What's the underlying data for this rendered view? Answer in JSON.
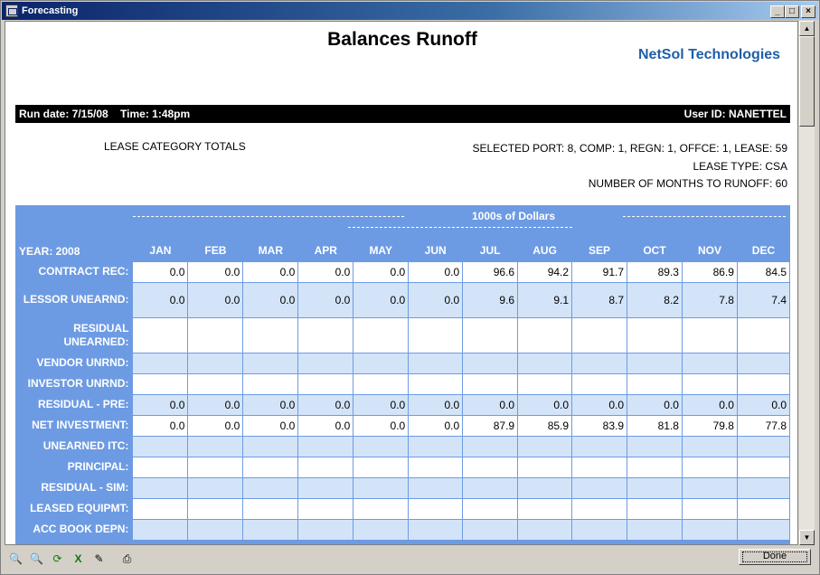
{
  "window": {
    "title": "Forecasting",
    "controls": [
      "_",
      "□",
      "×"
    ]
  },
  "report": {
    "title": "Balances Runoff",
    "brand": "NetSol Technologies",
    "run_info": "Run date: 7/15/08    Time: 1:48pm",
    "user_info": "User ID: NANETTEL",
    "category": "LEASE CATEGORY TOTALS",
    "params": [
      "SELECTED PORT: 8, COMP: 1, REGN: 1, OFFCE: 1, LEASE: 59",
      "LEASE TYPE: CSA",
      "NUMBER OF MONTHS TO RUNOFF: 60"
    ],
    "units": "1000s of Dollars"
  },
  "table": {
    "year_label": "YEAR: 2008",
    "months": [
      "JAN",
      "FEB",
      "MAR",
      "APR",
      "MAY",
      "JUN",
      "JUL",
      "AUG",
      "SEP",
      "OCT",
      "NOV",
      "DEC"
    ],
    "rows": [
      {
        "label": "CONTRACT REC:",
        "values": [
          "0.0",
          "0.0",
          "0.0",
          "0.0",
          "0.0",
          "0.0",
          "96.6",
          "94.2",
          "91.7",
          "89.3",
          "86.9",
          "84.5"
        ]
      },
      {
        "label": "LESSOR UNEARND:",
        "values": [
          "0.0",
          "0.0",
          "0.0",
          "0.0",
          "0.0",
          "0.0",
          "9.6",
          "9.1",
          "8.7",
          "8.2",
          "7.8",
          "7.4"
        ]
      },
      {
        "label": "RESIDUAL UNEARNED:",
        "values": [
          "",
          "",
          "",
          "",
          "",
          "",
          "",
          "",
          "",
          "",
          "",
          ""
        ]
      },
      {
        "label": "VENDOR UNRND:",
        "values": [
          "",
          "",
          "",
          "",
          "",
          "",
          "",
          "",
          "",
          "",
          "",
          ""
        ]
      },
      {
        "label": "INVESTOR UNRND:",
        "values": [
          "",
          "",
          "",
          "",
          "",
          "",
          "",
          "",
          "",
          "",
          "",
          ""
        ]
      },
      {
        "label": "RESIDUAL - PRE:",
        "values": [
          "0.0",
          "0.0",
          "0.0",
          "0.0",
          "0.0",
          "0.0",
          "0.0",
          "0.0",
          "0.0",
          "0.0",
          "0.0",
          "0.0"
        ]
      },
      {
        "label": "NET INVESTMENT:",
        "values": [
          "0.0",
          "0.0",
          "0.0",
          "0.0",
          "0.0",
          "0.0",
          "87.9",
          "85.9",
          "83.9",
          "81.8",
          "79.8",
          "77.8"
        ]
      },
      {
        "label": "UNEARNED ITC:",
        "values": [
          "",
          "",
          "",
          "",
          "",
          "",
          "",
          "",
          "",
          "",
          "",
          ""
        ]
      },
      {
        "label": "PRINCIPAL:",
        "values": [
          "",
          "",
          "",
          "",
          "",
          "",
          "",
          "",
          "",
          "",
          "",
          ""
        ]
      },
      {
        "label": "RESIDUAL - SIM:",
        "values": [
          "",
          "",
          "",
          "",
          "",
          "",
          "",
          "",
          "",
          "",
          "",
          ""
        ]
      },
      {
        "label": "LEASED EQUIPMT:",
        "values": [
          "",
          "",
          "",
          "",
          "",
          "",
          "",
          "",
          "",
          "",
          "",
          ""
        ]
      },
      {
        "label": "ACC BOOK DEPN:",
        "values": [
          "",
          "",
          "",
          "",
          "",
          "",
          "",
          "",
          "",
          "",
          "",
          ""
        ]
      }
    ]
  },
  "toolbar": {
    "tools": [
      {
        "name": "zoom-out-icon",
        "glyph": "🔍"
      },
      {
        "name": "zoom-in-icon",
        "glyph": "🔍"
      },
      {
        "name": "refresh-icon",
        "glyph": "⟳"
      },
      {
        "name": "excel-export-icon",
        "glyph": "X"
      },
      {
        "name": "pdf-export-icon",
        "glyph": "✎"
      },
      {
        "name": "print-icon",
        "glyph": "⎙"
      }
    ],
    "done_label": "Done"
  }
}
